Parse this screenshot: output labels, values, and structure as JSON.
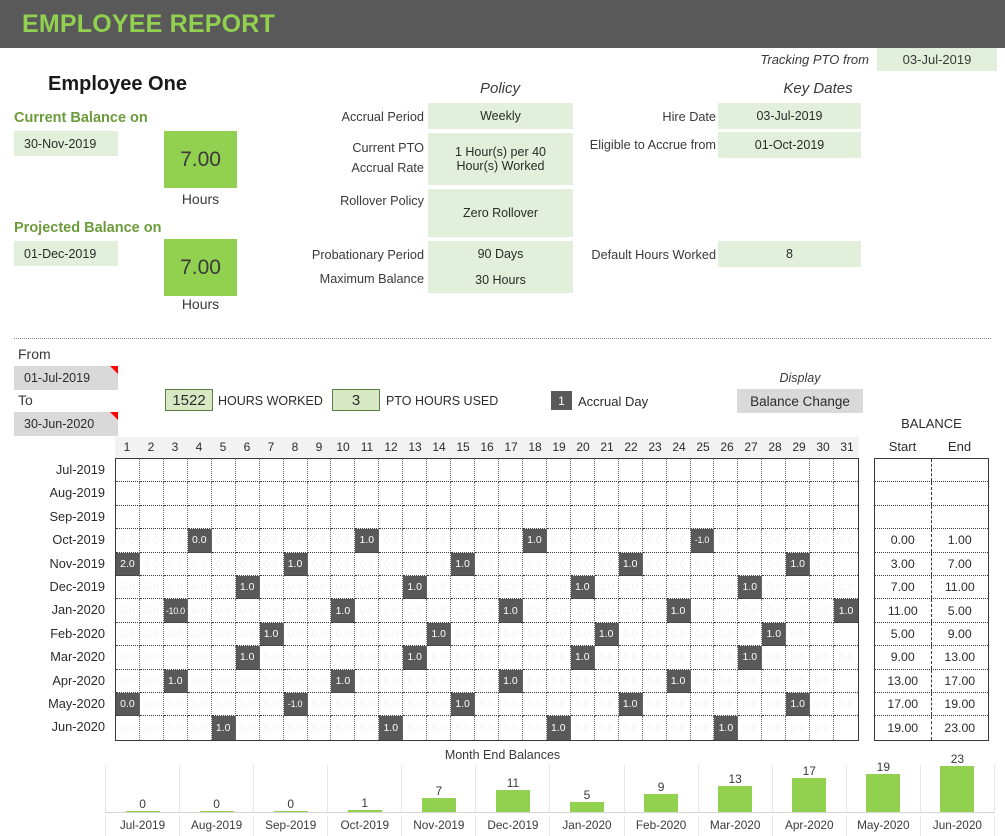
{
  "header": {
    "title": "EMPLOYEE REPORT"
  },
  "tracking": {
    "label": "Tracking PTO from",
    "value": "03-Jul-2019"
  },
  "employee": {
    "name": "Employee One"
  },
  "balances": {
    "current_heading": "Current Balance on",
    "current_date": "30-Nov-2019",
    "current_value": "7.00",
    "current_unit": "Hours",
    "projected_heading": "Projected Balance on",
    "projected_date": "01-Dec-2019",
    "projected_value": "7.00",
    "projected_unit": "Hours"
  },
  "policy": {
    "title": "Policy",
    "accrual_period_label": "Accrual Period",
    "accrual_period_value": "Weekly",
    "accrual_rate_label_line1": "Current PTO",
    "accrual_rate_label_line2": "Accrual Rate",
    "accrual_rate_value_line1": "1 Hour(s) per 40",
    "accrual_rate_value_line2": "Hour(s) Worked",
    "rollover_label": "Rollover Policy",
    "rollover_value": "Zero Rollover",
    "probationary_label": "Probationary Period",
    "probationary_value": "90 Days",
    "maximum_label": "Maximum Balance",
    "maximum_value": "30 Hours"
  },
  "key_dates": {
    "title": "Key Dates",
    "hire_date_label": "Hire Date",
    "hire_date_value": "03-Jul-2019",
    "eligible_label": "Eligible to Accrue from",
    "eligible_value": "01-Oct-2019",
    "default_hours_label": "Default Hours Worked",
    "default_hours_value": "8"
  },
  "filters": {
    "from_label": "From",
    "from_value": "01-Jul-2019",
    "to_label": "To",
    "to_value": "30-Jun-2020",
    "hours_worked_value": "1522",
    "hours_worked_label": "HOURS WORKED",
    "pto_used_value": "3",
    "pto_used_label": "PTO HOURS USED",
    "accrual_day_badge": "1",
    "accrual_day_label": "Accrual Day",
    "display_label": "Display",
    "display_value": "Balance Change"
  },
  "grid": {
    "balance_header": "BALANCE",
    "start_header": "Start",
    "end_header": "End",
    "day_numbers": [
      1,
      2,
      3,
      4,
      5,
      6,
      7,
      8,
      9,
      10,
      11,
      12,
      13,
      14,
      15,
      16,
      17,
      18,
      19,
      20,
      21,
      22,
      23,
      24,
      25,
      26,
      27,
      28,
      29,
      30,
      31
    ],
    "rows": [
      {
        "month": "Jul-2019",
        "days": 31,
        "active": false,
        "marks": {},
        "start": "",
        "end": ""
      },
      {
        "month": "Aug-2019",
        "days": 31,
        "active": false,
        "marks": {},
        "start": "",
        "end": ""
      },
      {
        "month": "Sep-2019",
        "days": 30,
        "active": false,
        "marks": {},
        "start": "",
        "end": ""
      },
      {
        "month": "Oct-2019",
        "days": 31,
        "active": true,
        "marks": {
          "4": "0.0",
          "11": "1.0",
          "18": "1.0",
          "25": "-1.0"
        },
        "start": "0.00",
        "end": "1.00"
      },
      {
        "month": "Nov-2019",
        "days": 30,
        "active": true,
        "marks": {
          "1": "2.0",
          "8": "1.0",
          "15": "1.0",
          "22": "1.0",
          "29": "1.0"
        },
        "start": "3.00",
        "end": "7.00"
      },
      {
        "month": "Dec-2019",
        "days": 31,
        "active": true,
        "marks": {
          "6": "1.0",
          "13": "1.0",
          "20": "1.0",
          "27": "1.0"
        },
        "start": "7.00",
        "end": "11.00"
      },
      {
        "month": "Jan-2020",
        "days": 31,
        "active": true,
        "marks": {
          "3": "-10.0",
          "10": "1.0",
          "17": "1.0",
          "24": "1.0",
          "31": "1.0"
        },
        "start": "11.00",
        "end": "5.00"
      },
      {
        "month": "Feb-2020",
        "days": 29,
        "active": true,
        "marks": {
          "7": "1.0",
          "14": "1.0",
          "21": "1.0",
          "28": "1.0"
        },
        "start": "5.00",
        "end": "9.00"
      },
      {
        "month": "Mar-2020",
        "days": 31,
        "active": true,
        "marks": {
          "6": "1.0",
          "13": "1.0",
          "20": "1.0",
          "27": "1.0"
        },
        "start": "9.00",
        "end": "13.00"
      },
      {
        "month": "Apr-2020",
        "days": 30,
        "active": true,
        "marks": {
          "3": "1.0",
          "10": "1.0",
          "17": "1.0",
          "24": "1.0"
        },
        "start": "13.00",
        "end": "17.00"
      },
      {
        "month": "May-2020",
        "days": 31,
        "active": true,
        "marks": {
          "1": "0.0",
          "8": "-1.0",
          "15": "1.0",
          "22": "1.0",
          "29": "1.0"
        },
        "start": "17.00",
        "end": "19.00"
      },
      {
        "month": "Jun-2020",
        "days": 30,
        "active": true,
        "marks": {
          "5": "1.0",
          "12": "1.0",
          "19": "1.0",
          "26": "1.0"
        },
        "start": "19.00",
        "end": "23.00"
      }
    ]
  },
  "chart_data": {
    "type": "bar",
    "title": "Month End Balances",
    "xlabel": "",
    "ylabel": "",
    "grid": false,
    "legend": "none",
    "ylim": [
      0,
      23
    ],
    "categories": [
      "Jul-2019",
      "Aug-2019",
      "Sep-2019",
      "Oct-2019",
      "Nov-2019",
      "Dec-2019",
      "Jan-2020",
      "Feb-2020",
      "Mar-2020",
      "Apr-2020",
      "May-2020",
      "Jun-2020"
    ],
    "values": [
      0,
      0,
      0,
      1,
      7,
      11,
      5,
      9,
      13,
      17,
      19,
      23
    ]
  },
  "colors": {
    "brand_green": "#92d050",
    "header_bar": "#595959",
    "light_green": "#e2efda",
    "grey_input": "#d9d9d9"
  }
}
